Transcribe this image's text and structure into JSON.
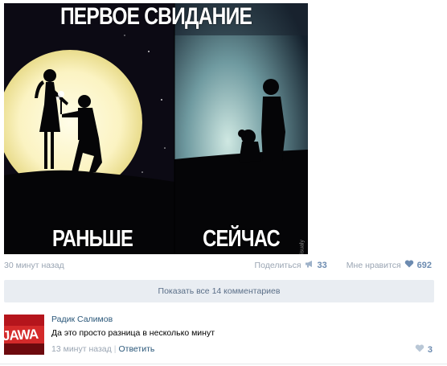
{
  "post": {
    "image": {
      "title": "ПЕРВОЕ СВИДАНИЕ",
      "caption_left": "РАНЬШЕ",
      "caption_right": "СЕЙЧАС",
      "watermark": "visualy"
    },
    "time": "30 минут назад",
    "share_label": "Поделиться",
    "share_count": "33",
    "like_label": "Мне нравится",
    "like_count": "692"
  },
  "comments": {
    "show_all_label": "Показать все 14 комментариев",
    "items": [
      {
        "author": "Радик Салимов",
        "avatar_text": "JAWA",
        "text": "Да это просто разница в несколько минут",
        "time": "13 минут назад",
        "reply_label": "Ответить",
        "likes": "3"
      }
    ]
  },
  "colors": {
    "link": "#2b587a",
    "muted": "#9aa5b3",
    "count": "#6c8bb0",
    "show_all_bg": "#e9edf2",
    "avatar_bg": "#b5151c"
  },
  "icons": {
    "share": "megaphone-icon",
    "like": "heart-icon",
    "comment_like": "heart-icon"
  }
}
